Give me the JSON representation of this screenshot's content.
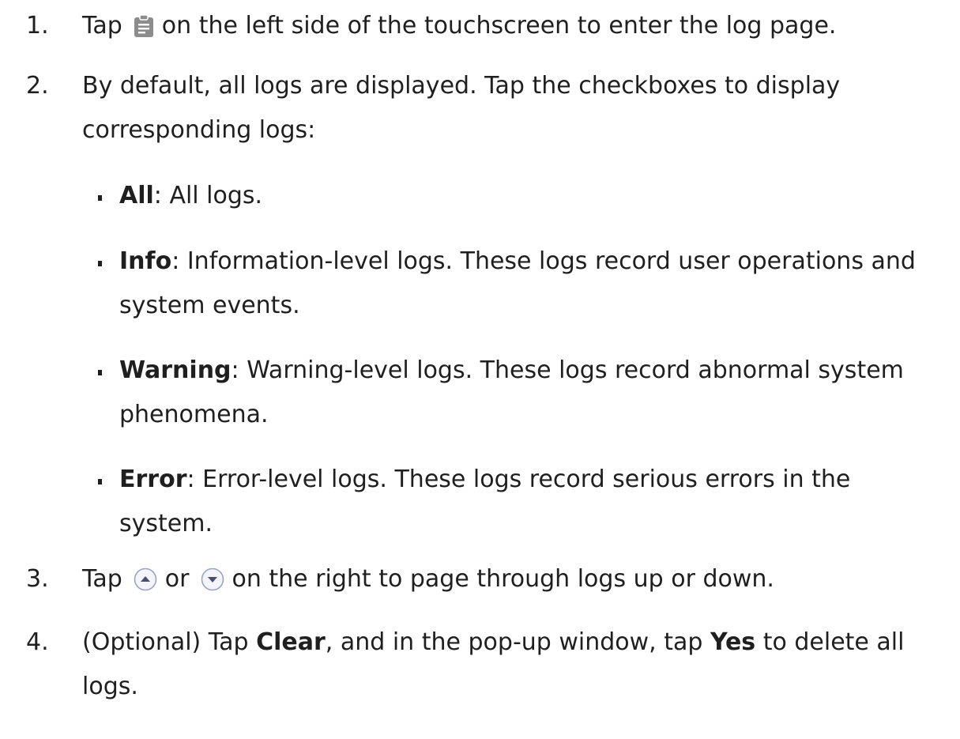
{
  "steps": [
    {
      "number": "1.",
      "before_icon": "Tap",
      "icon": "clipboard-icon",
      "after_icon": "on the left side of the touchscreen to enter the log page."
    },
    {
      "number": "2.",
      "line1": "By default, all logs are displayed. Tap the checkboxes to display",
      "line2": "corresponding logs:",
      "bullets": [
        {
          "term": "All",
          "desc": ": All logs.",
          "desc2": ""
        },
        {
          "term": "Info",
          "desc": ": Information-level logs. These logs record user operations and",
          "desc2": "system events."
        },
        {
          "term": "Warning",
          "desc": ": Warning-level logs. These logs record abnormal system",
          "desc2": "phenomena."
        },
        {
          "term": "Error",
          "desc": ": Error-level logs. These logs record serious errors in the",
          "desc2": "system."
        }
      ]
    },
    {
      "number": "3.",
      "tap": "Tap",
      "up_icon": "page-up-icon",
      "or": "or",
      "down_icon": "page-down-icon",
      "rest": "on the right to page through logs up or down."
    },
    {
      "number": "4.",
      "p1": "(Optional) Tap ",
      "clear": "Clear",
      "p2": ", and in the pop-up window, tap ",
      "yes": "Yes",
      "p3": " to delete all",
      "line2": "logs."
    }
  ],
  "colors": {
    "text": "#1f1f1f",
    "icon_gray": "#8c8c8c",
    "icon_circle_stroke": "#9aa3c4",
    "icon_circle_fill": "#f4f5fa"
  }
}
